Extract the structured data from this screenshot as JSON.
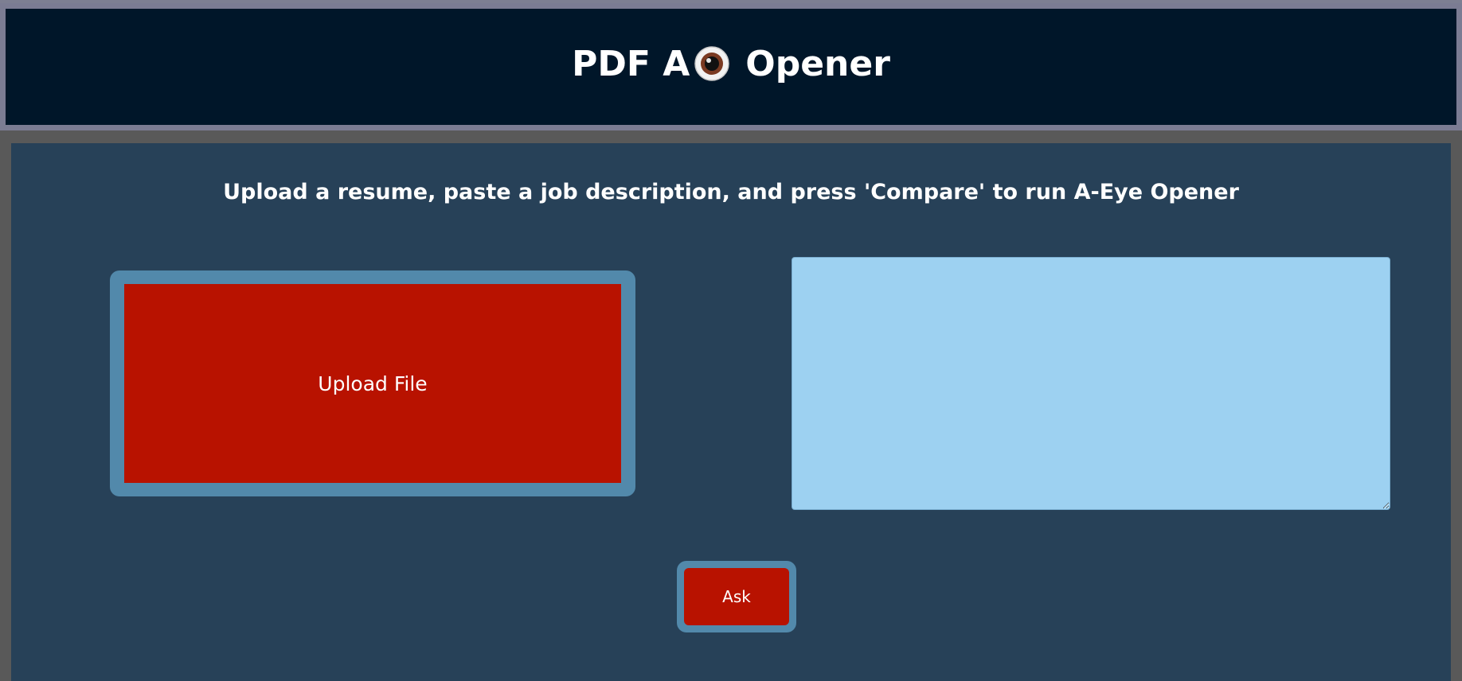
{
  "header": {
    "title_left": "PDF A",
    "title_right": "Opener",
    "eye_icon": "eye-icon"
  },
  "main": {
    "instructions": "Upload a resume, paste a job description, and press 'Compare' to run A-Eye Opener"
  },
  "upload": {
    "label": "Upload File"
  },
  "job_description": {
    "value": "",
    "placeholder": ""
  },
  "ask": {
    "label": "Ask"
  },
  "colors": {
    "header_bg": "#001629",
    "main_bg": "#274158",
    "button_red": "#b81200",
    "frame_blue": "#5289ab",
    "textarea_bg": "#9dd1f1"
  }
}
